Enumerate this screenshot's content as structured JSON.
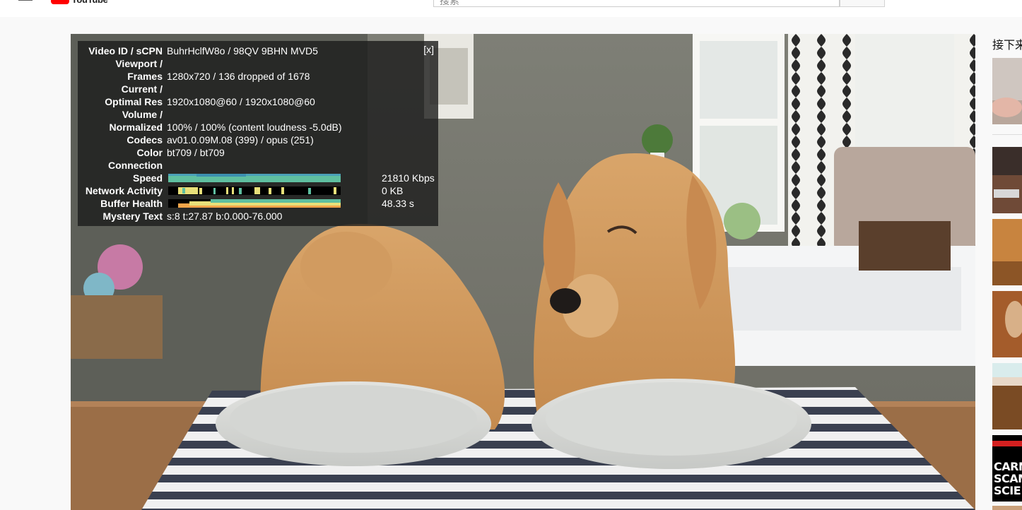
{
  "header": {
    "search_placeholder": "搜索"
  },
  "stats_overlay": {
    "close_label": "[x]",
    "rows": [
      {
        "label": "Video ID / sCPN",
        "value": "BuhrHclfW8o / 98QV 9BHN MVD5"
      },
      {
        "label": "Viewport /",
        "value": ""
      },
      {
        "label": "Frames",
        "value": "1280x720 / 136 dropped of 1678"
      },
      {
        "label": "Current /",
        "value": ""
      },
      {
        "label": "Optimal Res",
        "value": "1920x1080@60 / 1920x1080@60"
      },
      {
        "label": "Volume /",
        "value": ""
      },
      {
        "label": "Normalized",
        "value": "100% / 100% (content loudness -5.0dB)"
      },
      {
        "label": "Codecs",
        "value": "av01.0.09M.08 (399) / opus (251)"
      },
      {
        "label": "Color",
        "value": "bt709 / bt709"
      },
      {
        "label": "Connection",
        "value": ""
      },
      {
        "label": "Speed",
        "value": "21810 Kbps"
      },
      {
        "label": "Network Activity",
        "value": "0 KB"
      },
      {
        "label": "Buffer Health",
        "value": "48.33 s"
      },
      {
        "label": "Mystery Text",
        "value": "s:8 t:27.87 b:0.000-76.000"
      }
    ]
  },
  "sidebar": {
    "up_next_label": "接下来播放",
    "thumb_text": "CARNI SCAM SCIE"
  },
  "colors": {
    "youtube_red": "#ff0000",
    "graph_teal": "#5fbfa0",
    "graph_yellow": "#e8e07a",
    "graph_orange": "#f5a54a"
  }
}
